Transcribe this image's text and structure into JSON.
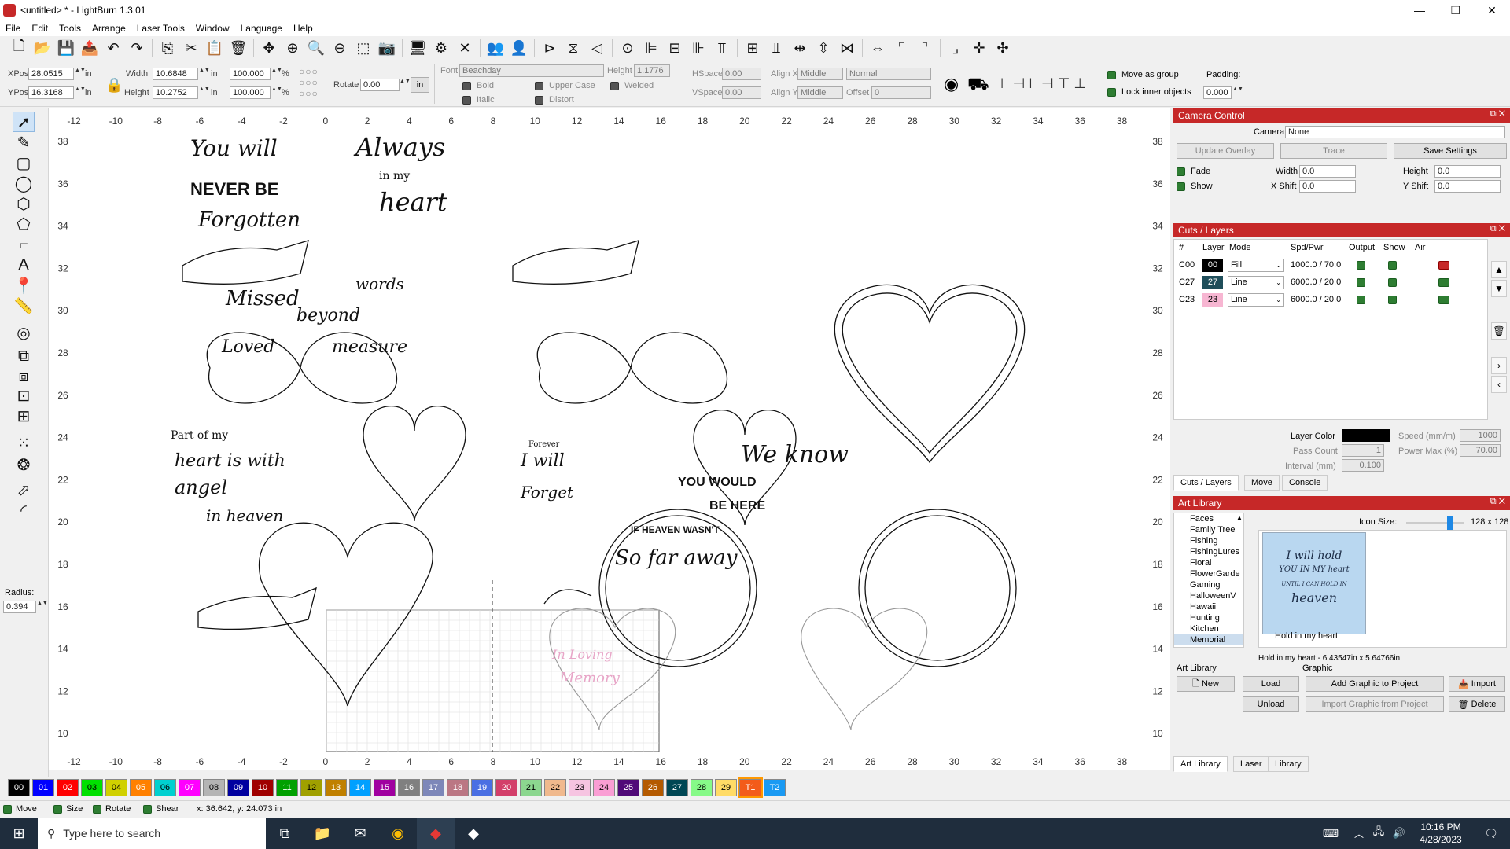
{
  "window": {
    "title": "<untitled> * - LightBurn 1.3.01",
    "minimize": "—",
    "maximize": "❐",
    "close": "✕"
  },
  "menu": [
    "File",
    "Edit",
    "Tools",
    "Arrange",
    "Laser Tools",
    "Window",
    "Language",
    "Help"
  ],
  "toolbar_icons": [
    {
      "name": "new-file-icon",
      "glyph": "🗋"
    },
    {
      "name": "open-folder-icon",
      "glyph": "📂"
    },
    {
      "name": "save-icon",
      "glyph": "💾"
    },
    {
      "name": "export-icon",
      "glyph": "📤"
    },
    {
      "name": "undo-icon",
      "glyph": "↶"
    },
    {
      "name": "redo-icon",
      "glyph": "↷"
    },
    {
      "name": "copy-icon",
      "glyph": "⎘"
    },
    {
      "name": "cut-icon",
      "glyph": "✂"
    },
    {
      "name": "paste-icon",
      "glyph": "📋"
    },
    {
      "name": "delete-icon",
      "glyph": "🗑"
    },
    {
      "name": "move-icon",
      "glyph": "✥"
    },
    {
      "name": "zoom-in-icon",
      "glyph": "⊕"
    },
    {
      "name": "zoom-in-alt-icon",
      "glyph": "🔍"
    },
    {
      "name": "zoom-out-icon",
      "glyph": "⊖"
    },
    {
      "name": "zoom-frame-icon",
      "glyph": "⬚"
    },
    {
      "name": "camera-icon",
      "glyph": "📷"
    },
    {
      "name": "monitor-icon",
      "glyph": "🖥"
    },
    {
      "name": "settings-icon",
      "glyph": "⚙"
    },
    {
      "name": "tools-icon",
      "glyph": "✕"
    },
    {
      "name": "group-icon",
      "glyph": "👥"
    },
    {
      "name": "ungroup-icon",
      "glyph": "👤"
    },
    {
      "name": "flip-h-icon",
      "glyph": "⊳"
    },
    {
      "name": "flip-v-icon",
      "glyph": "⧖"
    },
    {
      "name": "mirror-icon",
      "glyph": "◁"
    },
    {
      "name": "align-center-icon",
      "glyph": "⊙"
    },
    {
      "name": "align-left-icon",
      "glyph": "⊫"
    },
    {
      "name": "align-hcenter-icon",
      "glyph": "⊟"
    },
    {
      "name": "align-right-icon",
      "glyph": "⊪"
    },
    {
      "name": "align-top-icon",
      "glyph": "⫪"
    },
    {
      "name": "align-vcenter-icon",
      "glyph": "⊞"
    },
    {
      "name": "align-bottom-icon",
      "glyph": "⫫"
    },
    {
      "name": "distribute-h-icon",
      "glyph": "⇹"
    },
    {
      "name": "distribute-v-icon",
      "glyph": "⇳"
    },
    {
      "name": "move-together-icon",
      "glyph": "⋈"
    },
    {
      "name": "spread-icon",
      "glyph": "⇔"
    },
    {
      "name": "corner-tl-icon",
      "glyph": "⌜"
    },
    {
      "name": "corner-icon",
      "glyph": "⌝"
    },
    {
      "name": "corner-br-icon",
      "glyph": "⌟"
    },
    {
      "name": "center-page-icon",
      "glyph": "✛"
    },
    {
      "name": "crosshair-icon",
      "glyph": "✣"
    }
  ],
  "props": {
    "xpos_label": "XPos",
    "xpos": "28.0515",
    "ypos_label": "YPos",
    "ypos": "16.3168",
    "unit": "in",
    "width_label": "Width",
    "width": "10.6848",
    "height_label": "Height",
    "height": "10.2752",
    "scale_w": "100.000",
    "scale_h": "100.000",
    "percent": "%",
    "rotate_label": "Rotate",
    "rotate": "0.00",
    "in_btn": "in",
    "font_label": "Font",
    "font": "Beachday",
    "fheight_label": "Height",
    "fheight": "1.1776",
    "bold": "Bold",
    "italic": "Italic",
    "upper": "Upper Case",
    "distort": "Distort",
    "welded": "Welded",
    "hspace_label": "HSpace",
    "hspace": "0.00",
    "vspace_label": "VSpace",
    "vspace": "0.00",
    "alignx_label": "Align X",
    "alignx": "Middle",
    "aligny_label": "Align Y",
    "aligny": "Middle",
    "normal": "Normal",
    "offset_label": "Offset",
    "offset": "0",
    "move_group": "Move as group",
    "lock_inner": "Lock inner objects",
    "padding_label": "Padding:",
    "padding": "0.000"
  },
  "ruler": {
    "top": [
      "-12",
      "-10",
      "-8",
      "-6",
      "-4",
      "-2",
      "0",
      "2",
      "4",
      "6",
      "8",
      "10",
      "12",
      "14",
      "16",
      "18",
      "20",
      "22",
      "24",
      "26",
      "28",
      "30",
      "32",
      "34",
      "36",
      "38"
    ],
    "left": [
      "38",
      "36",
      "34",
      "32",
      "30",
      "28",
      "26",
      "24",
      "22",
      "20",
      "18",
      "16",
      "14",
      "12",
      "10"
    ]
  },
  "left_tools": [
    {
      "name": "select-icon",
      "glyph": "➚"
    },
    {
      "name": "pen-icon",
      "glyph": "✎"
    },
    {
      "name": "rectangle-icon",
      "glyph": "▢"
    },
    {
      "name": "ellipse-icon",
      "glyph": "◯"
    },
    {
      "name": "polygon-icon",
      "glyph": "⬡"
    },
    {
      "name": "edit-nodes-icon",
      "glyph": "⬠"
    },
    {
      "name": "frame-icon",
      "glyph": "⌐"
    },
    {
      "name": "text-icon",
      "glyph": "A"
    },
    {
      "name": "position-pin-icon",
      "glyph": "📍"
    },
    {
      "name": "measure-icon",
      "glyph": "📏"
    },
    {
      "name": "offset-icon",
      "glyph": "◎"
    },
    {
      "name": "boolean-union-icon",
      "glyph": "⧉"
    },
    {
      "name": "boolean-diff-icon",
      "glyph": "⧈"
    },
    {
      "name": "boolean-intersect-icon",
      "glyph": "⊡"
    },
    {
      "name": "weld-icon",
      "glyph": "⊞"
    },
    {
      "name": "grid-array-icon",
      "glyph": "⁙"
    },
    {
      "name": "circular-array-icon",
      "glyph": "❂"
    },
    {
      "name": "path-edit-icon",
      "glyph": "⬀"
    },
    {
      "name": "tab-icon",
      "glyph": "◜"
    }
  ],
  "radius_label": "Radius:",
  "radius": "0.394",
  "camera": {
    "title": "Camera Control",
    "camera_label": "Camera:",
    "camera": "None",
    "update_overlay": "Update Overlay",
    "trace": "Trace",
    "save_settings": "Save Settings",
    "fade": "Fade",
    "show": "Show",
    "width_label": "Width",
    "width": "0.0",
    "height_label": "Height",
    "height": "0.0",
    "xshift_label": "X Shift",
    "xshift": "0.0",
    "yshift_label": "Y Shift",
    "yshift": "0.0"
  },
  "cuts": {
    "title": "Cuts / Layers",
    "headers": [
      "#",
      "Layer",
      "Mode",
      "Spd/Pwr",
      "Output",
      "Show",
      "Air"
    ],
    "rows": [
      {
        "id": "C00",
        "layer": "00",
        "color": "#000000",
        "text": "#ffffff",
        "mode": "Fill",
        "spd": "1000.0 / 70.0",
        "air": "red"
      },
      {
        "id": "C27",
        "layer": "27",
        "color": "#1f4e5a",
        "text": "#ffffff",
        "mode": "Line",
        "spd": "6000.0 / 20.0",
        "air": "on"
      },
      {
        "id": "C23",
        "layer": "23",
        "color": "#f7b6d2",
        "text": "#000000",
        "mode": "Line",
        "spd": "6000.0 / 20.0",
        "air": "on"
      }
    ],
    "layer_color_label": "Layer Color",
    "speed_label": "Speed (mm/m)",
    "speed": "1000",
    "pass_label": "Pass Count",
    "pass": "1",
    "power_label": "Power Max (%)",
    "power": "70.00",
    "interval_label": "Interval (mm)",
    "interval": "0.100",
    "tabs": [
      "Cuts / Layers",
      "Move",
      "Console"
    ]
  },
  "artlib": {
    "title": "Art Library",
    "icon_size_label": "Icon Size:",
    "icon_size": "128 x 128",
    "categories": [
      "Faces",
      "Family Tree",
      "Fishing",
      "FishingLures",
      "Floral",
      "FlowerGarde",
      "Gaming",
      "HalloweenV",
      "Hawaii",
      "Hunting",
      "Kitchen",
      "Memorial"
    ],
    "selected": "Memorial",
    "preview_text": [
      "I will hold",
      "YOU IN MY heart",
      "UNTIL I CAN HOLD IN",
      "heaven"
    ],
    "item_label": "Hold in my heart",
    "info": "Hold in my heart - 6.43547in x 5.64766in",
    "section_lib": "Art Library",
    "section_graphic": "Graphic",
    "new": "New",
    "load": "Load",
    "unload": "Unload",
    "add_graphic": "Add Graphic to Project",
    "import_graphic": "Import Graphic from Project",
    "import": "Import",
    "delete": "Delete",
    "tabs": [
      "Art Library",
      "Laser",
      "Library"
    ]
  },
  "palette": [
    {
      "label": "00",
      "color": "#000000"
    },
    {
      "label": "01",
      "color": "#0000ff"
    },
    {
      "label": "02",
      "color": "#ff0000"
    },
    {
      "label": "03",
      "color": "#00e000"
    },
    {
      "label": "04",
      "color": "#d0d000"
    },
    {
      "label": "05",
      "color": "#ff8000"
    },
    {
      "label": "06",
      "color": "#00d0d0"
    },
    {
      "label": "07",
      "color": "#ff00ff"
    },
    {
      "label": "08",
      "color": "#b4b4b4"
    },
    {
      "label": "09",
      "color": "#0000a0"
    },
    {
      "label": "10",
      "color": "#a00000"
    },
    {
      "label": "11",
      "color": "#00a000"
    },
    {
      "label": "12",
      "color": "#a0a000"
    },
    {
      "label": "13",
      "color": "#c08000"
    },
    {
      "label": "14",
      "color": "#00a0ff"
    },
    {
      "label": "15",
      "color": "#a000a0"
    },
    {
      "label": "16",
      "color": "#808080"
    },
    {
      "label": "17",
      "color": "#7d87b9"
    },
    {
      "label": "18",
      "color": "#bb7784"
    },
    {
      "label": "19",
      "color": "#4a6fe3"
    },
    {
      "label": "20",
      "color": "#d33f6a"
    },
    {
      "label": "21",
      "color": "#8cd78f"
    },
    {
      "label": "22",
      "color": "#f0b98d"
    },
    {
      "label": "23",
      "color": "#f6c4e1"
    },
    {
      "label": "24",
      "color": "#fa9ed4"
    },
    {
      "label": "25",
      "color": "#500a78"
    },
    {
      "label": "26",
      "color": "#b45a00"
    },
    {
      "label": "27",
      "color": "#004754"
    },
    {
      "label": "28",
      "color": "#86fa88"
    },
    {
      "label": "29",
      "color": "#ffdb66"
    },
    {
      "label": "T1",
      "color": "#f35b1a"
    },
    {
      "label": "T2",
      "color": "#1a9af3"
    }
  ],
  "status": {
    "move": "Move",
    "size": "Size",
    "rotate": "Rotate",
    "shear": "Shear",
    "coords": "x: 36.642, y: 24.073 in"
  },
  "taskbar": {
    "search": "Type here to search",
    "time": "10:16 PM",
    "date": "4/28/2023"
  },
  "canvas_texts": [
    {
      "t": "You will",
      "s": "script"
    },
    {
      "t": "NEVER BE",
      "s": "caps"
    },
    {
      "t": "Forgotten",
      "s": "script"
    },
    {
      "t": "Always",
      "s": "script"
    },
    {
      "t": "in my",
      "s": "small"
    },
    {
      "t": "heart",
      "s": "script"
    },
    {
      "t": "Missed",
      "s": "script"
    },
    {
      "t": "beyond",
      "s": "script"
    },
    {
      "t": "words",
      "s": "script"
    },
    {
      "t": "Loved",
      "s": "script"
    },
    {
      "t": "measure",
      "s": "script"
    },
    {
      "t": "Part of my",
      "s": "small"
    },
    {
      "t": "heart is with",
      "s": "script"
    },
    {
      "t": "angel",
      "s": "script"
    },
    {
      "t": "in heaven",
      "s": "script"
    },
    {
      "t": "Forever",
      "s": "small"
    },
    {
      "t": "I will",
      "s": "script"
    },
    {
      "t": "Forget",
      "s": "script"
    },
    {
      "t": "We know",
      "s": "script"
    },
    {
      "t": "YOU WOULD",
      "s": "caps"
    },
    {
      "t": "BE HERE",
      "s": "caps"
    },
    {
      "t": "IF HEAVEN WASN'T",
      "s": "caps"
    },
    {
      "t": "So far away",
      "s": "script"
    },
    {
      "t": "In Loving",
      "s": "script"
    },
    {
      "t": "Memory",
      "s": "script"
    }
  ]
}
